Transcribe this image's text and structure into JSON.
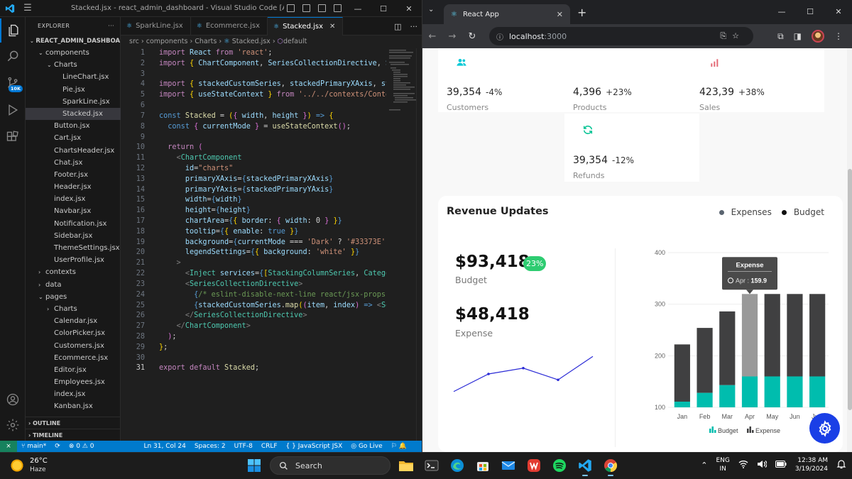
{
  "vscode": {
    "window_title": "Stacked.jsx - react_admin_dashboard - Visual Studio Code [Administr...",
    "explorer_label": "EXPLORER",
    "project": "REACT_ADMIN_DASHBOA...",
    "source_control_badge": "10K",
    "tree": [
      {
        "label": "components",
        "depth": 1,
        "folder": true
      },
      {
        "label": "Charts",
        "depth": 2,
        "folder": true
      },
      {
        "label": "LineChart.jsx",
        "depth": 3
      },
      {
        "label": "Pie.jsx",
        "depth": 3
      },
      {
        "label": "SparkLine.jsx",
        "depth": 3
      },
      {
        "label": "Stacked.jsx",
        "depth": 3,
        "selected": true
      },
      {
        "label": "Button.jsx",
        "depth": 2
      },
      {
        "label": "Cart.jsx",
        "depth": 2
      },
      {
        "label": "ChartsHeader.jsx",
        "depth": 2
      },
      {
        "label": "Chat.jsx",
        "depth": 2
      },
      {
        "label": "Footer.jsx",
        "depth": 2
      },
      {
        "label": "Header.jsx",
        "depth": 2
      },
      {
        "label": "index.jsx",
        "depth": 2
      },
      {
        "label": "Navbar.jsx",
        "depth": 2
      },
      {
        "label": "Notification.jsx",
        "depth": 2
      },
      {
        "label": "Sidebar.jsx",
        "depth": 2
      },
      {
        "label": "ThemeSettings.jsx",
        "depth": 2
      },
      {
        "label": "UserProfile.jsx",
        "depth": 2
      },
      {
        "label": "contexts",
        "depth": 1,
        "folder": true,
        "collapsed": true
      },
      {
        "label": "data",
        "depth": 1,
        "folder": true,
        "collapsed": true
      },
      {
        "label": "pages",
        "depth": 1,
        "folder": true
      },
      {
        "label": "Charts",
        "depth": 2,
        "folder": true,
        "collapsed": true
      },
      {
        "label": "Calendar.jsx",
        "depth": 2
      },
      {
        "label": "ColorPicker.jsx",
        "depth": 2
      },
      {
        "label": "Customers.jsx",
        "depth": 2
      },
      {
        "label": "Ecommerce.jsx",
        "depth": 2
      },
      {
        "label": "Editor.jsx",
        "depth": 2
      },
      {
        "label": "Employees.jsx",
        "depth": 2
      },
      {
        "label": "index.jsx",
        "depth": 2
      },
      {
        "label": "Kanban.jsx",
        "depth": 2
      }
    ],
    "outline_label": "OUTLINE",
    "timeline_label": "TIMELINE",
    "tabs": [
      {
        "label": "SparkLine.jsx",
        "active": false
      },
      {
        "label": "Ecommerce.jsx",
        "active": false
      },
      {
        "label": "Stacked.jsx",
        "active": true
      }
    ],
    "breadcrumb": [
      "src",
      "components",
      "Charts",
      "Stacked.jsx",
      "default"
    ],
    "current_line": 31,
    "status": {
      "branch": "main*",
      "problems": "⊗ 0 ⚠ 0",
      "position": "Ln 31, Col 24",
      "spaces": "Spaces: 2",
      "encoding": "UTF-8",
      "eol": "CRLF",
      "language": "{ } JavaScript JSX",
      "golive": "Go Live"
    }
  },
  "browser": {
    "tab_title": "React App",
    "url_host": "localhost",
    "url_port": ":3000"
  },
  "dashboard": {
    "stats": [
      {
        "value": "39,354",
        "pct": "-4%",
        "label": "Customers",
        "icon": "customers-icon",
        "icon_color": "#03C9D7",
        "bg": "#E5FAFB"
      },
      {
        "value": "4,396",
        "pct": "+23%",
        "label": "Products",
        "icon": "box-icon",
        "icon_color": "#FFFFFF",
        "bg": "#FEC90F"
      },
      {
        "value": "423,39",
        "pct": "+38%",
        "label": "Sales",
        "icon": "bar-chart-icon",
        "icon_color": "#E46A76",
        "bg": "#FFF4ED"
      },
      {
        "value": "39,354",
        "pct": "-12%",
        "label": "Refunds",
        "icon": "refresh-icon",
        "icon_color": "#00C292",
        "bg": "#EBFAF2"
      }
    ],
    "revenue": {
      "title": "Revenue Updates",
      "legend": [
        {
          "label": "Expenses",
          "color": "#5a6470"
        },
        {
          "label": "Budget",
          "color": "#111111"
        }
      ],
      "budget_value": "$93,418",
      "budget_pct": "23%",
      "budget_label": "Budget",
      "expense_value": "$48,418",
      "expense_label": "Expense",
      "tooltip": {
        "title": "Expense",
        "month": "Apr",
        "value": "159.9"
      },
      "bottom_legend": [
        "Budget",
        "Expense"
      ]
    }
  },
  "chart_data": [
    {
      "type": "line",
      "title": "",
      "series": [
        {
          "values": [
            1,
            4,
            5,
            3,
            7
          ]
        }
      ],
      "x": [
        1,
        2,
        3,
        4,
        5
      ],
      "color": "#2b2bd6"
    },
    {
      "type": "bar",
      "stacked": true,
      "categories": [
        "Jan",
        "Feb",
        "Mar",
        "Apr",
        "May",
        "Jun",
        "July"
      ],
      "series": [
        {
          "name": "Budget",
          "values": [
            111,
            128,
            143,
            159.9,
            159.9,
            159.9,
            159.9
          ],
          "color": "#00BDAE"
        },
        {
          "name": "Expense",
          "values": [
            111,
            126,
            143,
            159.9,
            159.9,
            159.9,
            159.9
          ],
          "color": "#404041"
        }
      ],
      "ylim": [
        100,
        400
      ],
      "yticks": [
        100,
        200,
        300,
        400
      ],
      "highlight_index": 3,
      "highlight_color": "#999999"
    }
  ],
  "taskbar": {
    "weather_temp": "26°C",
    "weather_desc": "Haze",
    "search_label": "Search",
    "lang1": "ENG",
    "lang2": "IN",
    "time": "12:38 AM",
    "date": "3/19/2024"
  }
}
